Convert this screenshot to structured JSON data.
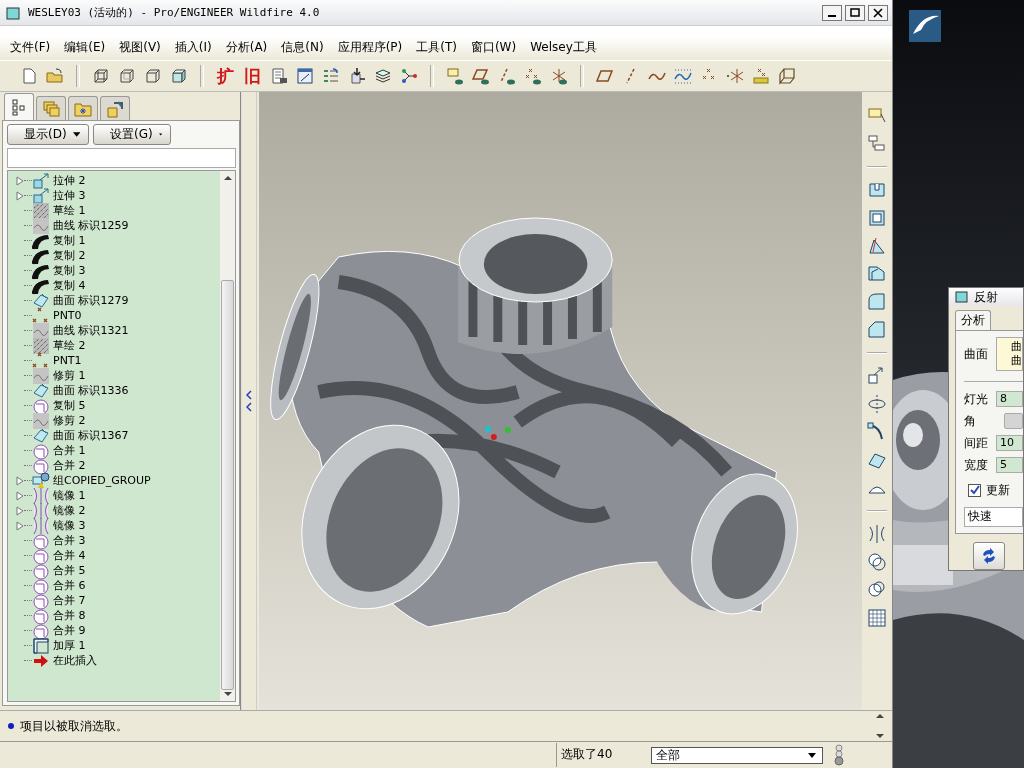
{
  "window": {
    "title": "WESLEY03 (活动的) - Pro/ENGINEER Wildfire 4.0"
  },
  "menu": [
    "文件(F)",
    "编辑(E)",
    "视图(V)",
    "插入(I)",
    "分析(A)",
    "信息(N)",
    "应用程序(P)",
    "工具(T)",
    "窗口(W)",
    "Welsey工具"
  ],
  "toolbar": {
    "glyph_buttons": [
      "扩",
      "旧"
    ]
  },
  "side_tabs": [
    {
      "kind": "tree",
      "selected": true
    },
    {
      "kind": "layers",
      "selected": false
    },
    {
      "kind": "folder",
      "selected": false
    },
    {
      "kind": "tools",
      "selected": false
    }
  ],
  "panel_buttons": [
    "显示(D)",
    "设置(G)"
  ],
  "tree": [
    {
      "label": "拉伸 2",
      "kind": "extrude",
      "expandable": true
    },
    {
      "label": "拉伸 3",
      "kind": "extrude",
      "expandable": true
    },
    {
      "label": "草绘 1",
      "kind": "sketch",
      "expandable": false
    },
    {
      "label": "曲线 标识1259",
      "kind": "curve",
      "expandable": false
    },
    {
      "label": "复制 1",
      "kind": "copy",
      "expandable": false
    },
    {
      "label": "复制 2",
      "kind": "copy",
      "expandable": false
    },
    {
      "label": "复制 3",
      "kind": "copy",
      "expandable": false
    },
    {
      "label": "复制 4",
      "kind": "copy",
      "expandable": false
    },
    {
      "label": "曲面 标识1279",
      "kind": "surface",
      "expandable": false
    },
    {
      "label": "PNT0",
      "kind": "point",
      "expandable": false
    },
    {
      "label": "曲线 标识1321",
      "kind": "curve",
      "expandable": false
    },
    {
      "label": "草绘 2",
      "kind": "sketch",
      "expandable": false
    },
    {
      "label": "PNT1",
      "kind": "point",
      "expandable": false
    },
    {
      "label": "修剪 1",
      "kind": "curve",
      "expandable": false
    },
    {
      "label": "曲面 标识1336",
      "kind": "surface",
      "expandable": false
    },
    {
      "label": "复制 5",
      "kind": "merge",
      "expandable": false
    },
    {
      "label": "修剪 2",
      "kind": "curve",
      "expandable": false
    },
    {
      "label": "曲面 标识1367",
      "kind": "surface",
      "expandable": false
    },
    {
      "label": "合并 1",
      "kind": "merge",
      "expandable": false
    },
    {
      "label": "合并 2",
      "kind": "merge",
      "expandable": false
    },
    {
      "label": "组COPIED_GROUP",
      "kind": "group",
      "expandable": true
    },
    {
      "label": "镜像 1",
      "kind": "mirror",
      "expandable": true
    },
    {
      "label": "镜像 2",
      "kind": "mirror",
      "expandable": true
    },
    {
      "label": "镜像 3",
      "kind": "mirror",
      "expandable": true
    },
    {
      "label": "合并 3",
      "kind": "merge",
      "expandable": false
    },
    {
      "label": "合并 4",
      "kind": "merge",
      "expandable": false
    },
    {
      "label": "合并 5",
      "kind": "merge",
      "expandable": false
    },
    {
      "label": "合并 6",
      "kind": "merge",
      "expandable": false
    },
    {
      "label": "合并 7",
      "kind": "merge",
      "expandable": false
    },
    {
      "label": "合并 8",
      "kind": "merge",
      "expandable": false
    },
    {
      "label": "合并 9",
      "kind": "merge",
      "expandable": false
    },
    {
      "label": "加厚 1",
      "kind": "thicken",
      "expandable": false
    },
    {
      "label": "在此插入",
      "kind": "insert",
      "expandable": false
    }
  ],
  "message": "项目以被取消选取。",
  "status_bar": {
    "selection": "选取了40",
    "filter": "全部"
  },
  "dialog": {
    "title": "反射",
    "tabs": [
      {
        "label": "分析",
        "selected": true
      }
    ],
    "surface_label": "曲面",
    "surface_list": [
      "曲",
      "曲"
    ],
    "fields": [
      {
        "label": "灯光",
        "value": "8",
        "disabled": false
      },
      {
        "label": "角",
        "disabled": true
      },
      {
        "label": "间距",
        "value": "10",
        "disabled": false
      },
      {
        "label": "宽度",
        "value": "5",
        "disabled": false
      }
    ],
    "update": {
      "label": "更新",
      "checked": true
    },
    "mode": "快速"
  }
}
